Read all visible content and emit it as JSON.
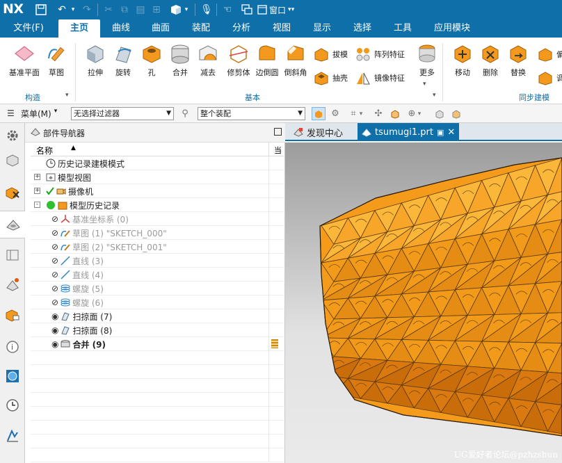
{
  "app": {
    "logo": "NX",
    "window_menu": "窗口"
  },
  "menu": [
    "文件(F)",
    "主页",
    "曲线",
    "曲面",
    "装配",
    "分析",
    "视图",
    "显示",
    "选择",
    "工具",
    "应用模块"
  ],
  "menu_active": "主页",
  "ribbon": {
    "construct": {
      "datum_plane": "基准平面",
      "sketch": "草图",
      "label": "构造"
    },
    "basic": {
      "extrude": "拉伸",
      "revolve": "旋转",
      "hole": "孔",
      "unite": "合并",
      "subtract": "减去",
      "trim_body": "修剪体",
      "edge_blend": "边倒圆",
      "chamfer": "倒斜角",
      "draft": "拔模",
      "shell": "抽壳",
      "pattern": "阵列特征",
      "mirror": "镜像特征",
      "more": "更多",
      "label": "基本"
    },
    "sync": {
      "move": "移动",
      "delete": "删除",
      "replace": "替换",
      "partial1": "偏",
      "partial2": "调",
      "label": "同步建模"
    }
  },
  "filterbar": {
    "menu": "菜单(M)",
    "filter": "无选择过滤器",
    "assembly": "整个装配"
  },
  "navigator": {
    "title": "部件导航器",
    "col_name": "名称",
    "col_current": "当",
    "rows": [
      {
        "label": "历史记录建模模式",
        "level": 0,
        "expander": "",
        "dim": false,
        "bold": false
      },
      {
        "label": "模型视图",
        "level": 0,
        "expander": "+",
        "dim": false,
        "bold": false
      },
      {
        "label": "摄像机",
        "level": 0,
        "expander": "+",
        "dim": false,
        "bold": false
      },
      {
        "label": "模型历史记录",
        "level": 0,
        "expander": "-",
        "dim": false,
        "bold": false
      },
      {
        "label": "基准坐标系 (0)",
        "level": 1,
        "expander": "",
        "dim": true,
        "bold": false
      },
      {
        "label": "草图 (1) \"SKETCH_000\"",
        "level": 1,
        "expander": "",
        "dim": true,
        "bold": false
      },
      {
        "label": "草图 (2) \"SKETCH_001\"",
        "level": 1,
        "expander": "",
        "dim": true,
        "bold": false
      },
      {
        "label": "直线 (3)",
        "level": 1,
        "expander": "",
        "dim": true,
        "bold": false
      },
      {
        "label": "直线 (4)",
        "level": 1,
        "expander": "",
        "dim": true,
        "bold": false
      },
      {
        "label": "螺旋 (5)",
        "level": 1,
        "expander": "",
        "dim": true,
        "bold": false
      },
      {
        "label": "螺旋 (6)",
        "level": 1,
        "expander": "",
        "dim": true,
        "bold": false
      },
      {
        "label": "扫掠面 (7)",
        "level": 1,
        "expander": "",
        "dim": false,
        "bold": false
      },
      {
        "label": "扫掠面 (8)",
        "level": 1,
        "expander": "",
        "dim": false,
        "bold": false
      },
      {
        "label": "合并 (9)",
        "level": 1,
        "expander": "",
        "dim": false,
        "bold": true
      }
    ]
  },
  "tabs": {
    "discover": "发现中心",
    "file": "tsumugi1.prt"
  },
  "watermark": "UG爱好者论坛@pzhzshun",
  "colors": {
    "accent": "#0f6fa8",
    "model": "#f39a1e"
  }
}
